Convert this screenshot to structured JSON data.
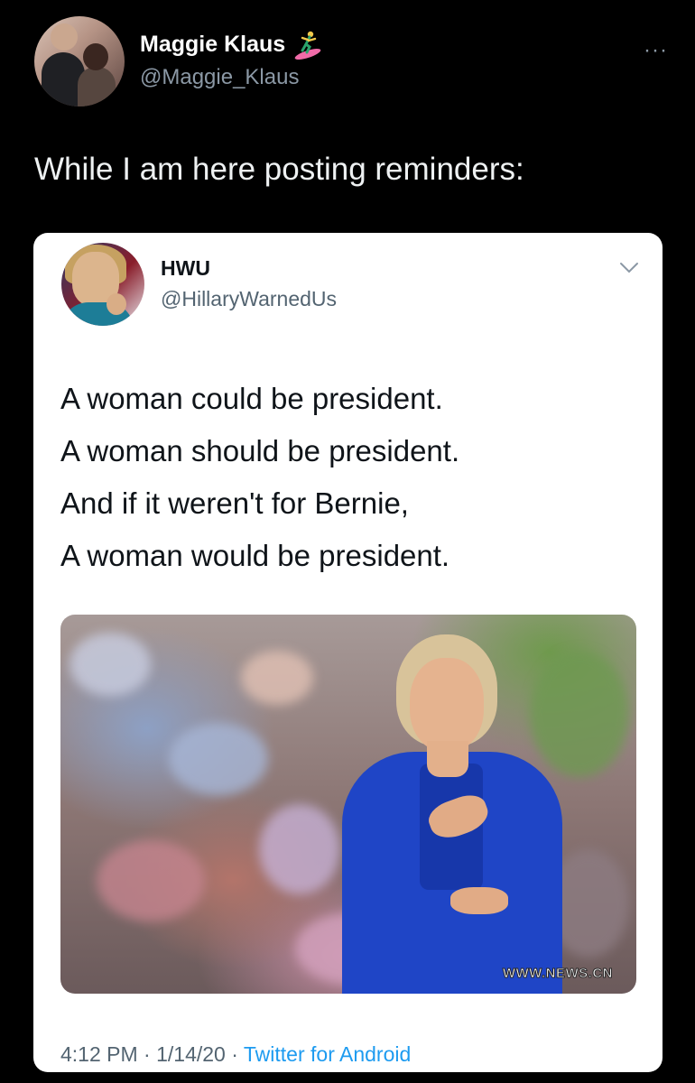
{
  "post": {
    "display_name": "Maggie Klaus",
    "name_emoji": "person-surfing-icon",
    "handle": "@Maggie_Klaus",
    "more_label": "···",
    "text": "While I am here posting reminders:"
  },
  "quoted_tweet": {
    "display_name": "HWU",
    "handle": "@HillaryWarnedUs",
    "lines": [
      "A woman could be president.",
      "A woman should be president.",
      "And if it weren't for Bernie,",
      "A woman would be president."
    ],
    "image_watermark": "WWW.NEWS.CN",
    "time": "4:12 PM",
    "date": "1/14/20",
    "source": "Twitter for Android",
    "separator": "·"
  },
  "colors": {
    "background": "#000000",
    "link_blue": "#1d9bf0",
    "muted": "#8b98a5"
  }
}
